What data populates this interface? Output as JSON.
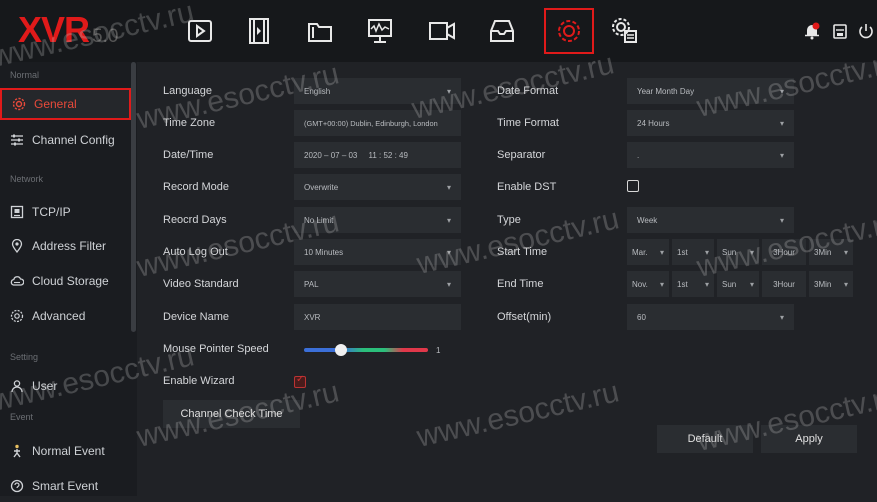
{
  "app": {
    "logo": "XVR",
    "version": "5.0"
  },
  "topbar": {
    "icons": [
      "playback-icon",
      "video-clip-icon",
      "folder-icon",
      "monitor-chart-icon",
      "camera-icon",
      "storage-icon",
      "settings-icon",
      "maintenance-icon"
    ],
    "active": "settings-icon",
    "right_icons": [
      "alarm-bell-icon",
      "backup-icon",
      "power-icon"
    ]
  },
  "sidebar": {
    "sections": {
      "normal": "Normal",
      "network": "Network",
      "setting": "Setting",
      "event": "Event"
    },
    "items": {
      "general": "General",
      "channel_config": "Channel Config",
      "tcpip": "TCP/IP",
      "address_filter": "Address Filter",
      "cloud_storage": "Cloud Storage",
      "advanced": "Advanced",
      "user": "User",
      "normal_event": "Normal Event",
      "smart_event": "Smart Event"
    }
  },
  "form": {
    "language": {
      "label": "Language",
      "value": "English"
    },
    "time_zone": {
      "label": "Time Zone",
      "value": "(GMT+00:00) Dublin, Edinburgh, London"
    },
    "date_time": {
      "label": "Date/Time",
      "value": "2020 – 07 – 03     11 : 52 : 49"
    },
    "record_mode": {
      "label": "Record Mode",
      "value": "Overwrite"
    },
    "record_days": {
      "label": "Reocrd Days",
      "value": "No Limit"
    },
    "auto_logout": {
      "label": "Auto Log Out",
      "value": "10 Minutes"
    },
    "video_standard": {
      "label": "Video Standard",
      "value": "PAL"
    },
    "device_name": {
      "label": "Device Name",
      "value": "XVR"
    },
    "mouse_speed": {
      "label": "Mouse Pointer Speed",
      "value": "1",
      "level": 0.3
    },
    "enable_wizard": {
      "label": "Enable Wizard",
      "checked": true
    },
    "channel_check_time": {
      "label": "Channel Check Time"
    },
    "date_format": {
      "label": "Date Format",
      "value": "Year Month Day"
    },
    "time_format": {
      "label": "Time Format",
      "value": "24 Hours"
    },
    "separator": {
      "label": "Separator",
      "value": "."
    },
    "enable_dst": {
      "label": "Enable DST",
      "checked": false
    },
    "type": {
      "label": "Type",
      "value": "Week"
    },
    "start_time": {
      "label": "Start Time",
      "month": "Mar.",
      "week": "1st",
      "day": "Sun",
      "hour": "3Hour",
      "min": "3Min"
    },
    "end_time": {
      "label": "End Time",
      "month": "Nov.",
      "week": "1st",
      "day": "Sun",
      "hour": "3Hour",
      "min": "3Min"
    },
    "offset": {
      "label": "Offset(min)",
      "value": "60"
    }
  },
  "buttons": {
    "default": "Default",
    "apply": "Apply"
  },
  "watermark": "www.esocctv.ru",
  "colors": {
    "accent": "#e01a1a",
    "background": "#202226",
    "field": "#2a2d31"
  }
}
